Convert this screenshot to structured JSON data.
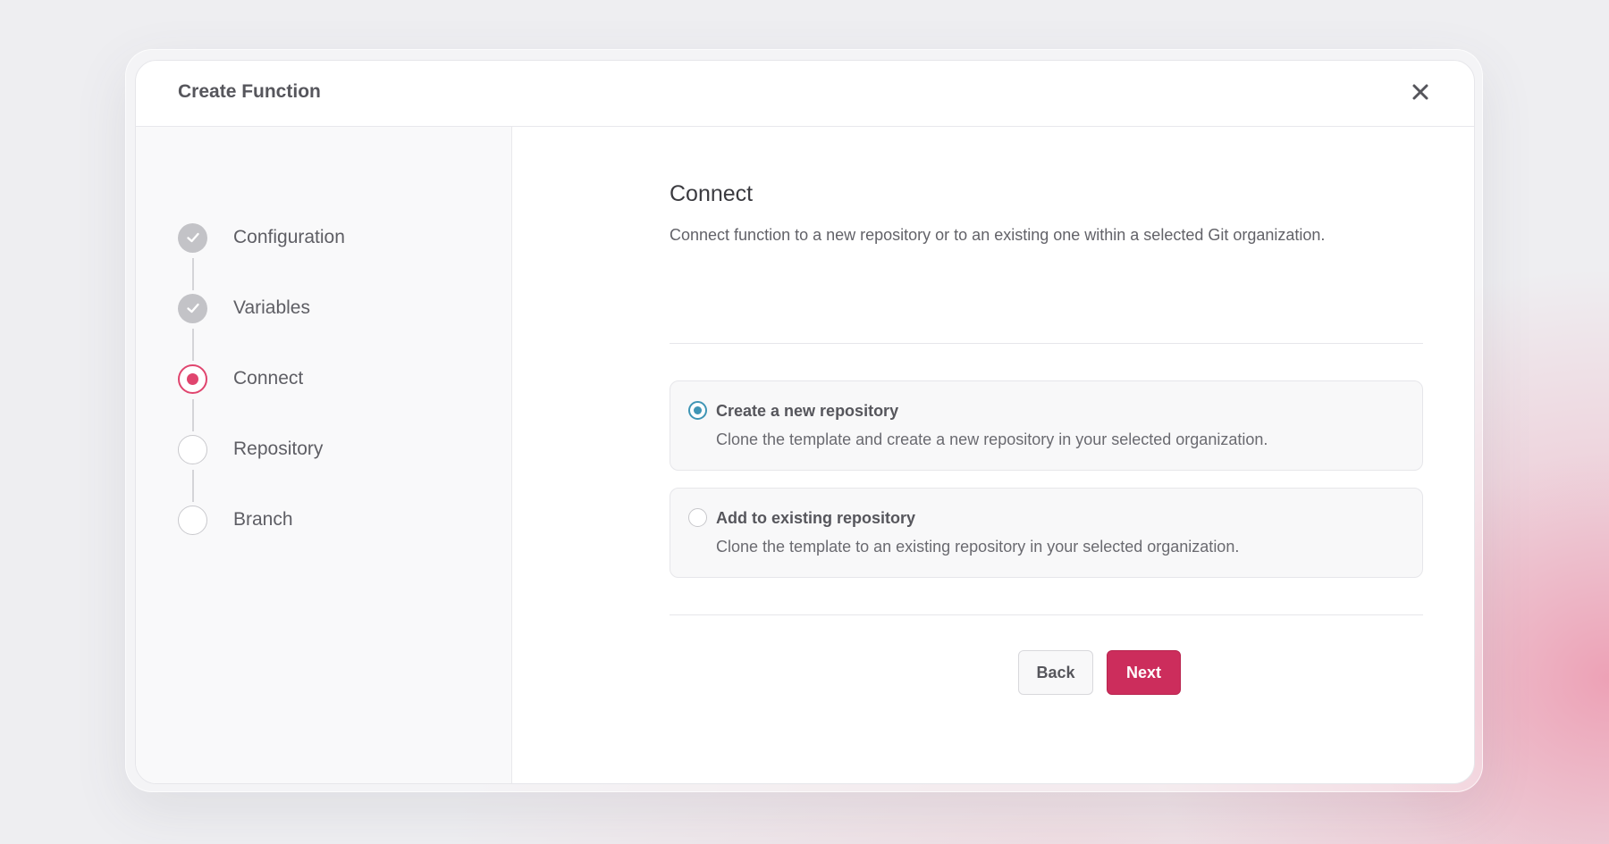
{
  "modal": {
    "title": "Create Function",
    "close_icon": "close-icon"
  },
  "steps": [
    {
      "label": "Configuration",
      "status": "completed",
      "icon": "check-icon"
    },
    {
      "label": "Variables",
      "status": "completed",
      "icon": "check-icon"
    },
    {
      "label": "Connect",
      "status": "current",
      "icon": "dot-icon"
    },
    {
      "label": "Repository",
      "status": "pending",
      "icon": "empty-circle-icon"
    },
    {
      "label": "Branch",
      "status": "pending",
      "icon": "empty-circle-icon"
    }
  ],
  "main": {
    "title": "Connect",
    "description": "Connect function to a new repository or to an existing one within a selected Git organization.",
    "options": [
      {
        "title": "Create a new repository",
        "description": "Clone the template and create a new repository in your selected organization.",
        "selected": true
      },
      {
        "title": "Add to existing repository",
        "description": "Clone the template to an existing repository in your selected organization.",
        "selected": false
      }
    ]
  },
  "actions": {
    "back_label": "Back",
    "next_label": "Next"
  },
  "colors": {
    "accent": "#cc2d5c",
    "step_current": "#e0456e",
    "radio_selected": "#3f95b5",
    "step_completed": "#c3c3c7"
  }
}
